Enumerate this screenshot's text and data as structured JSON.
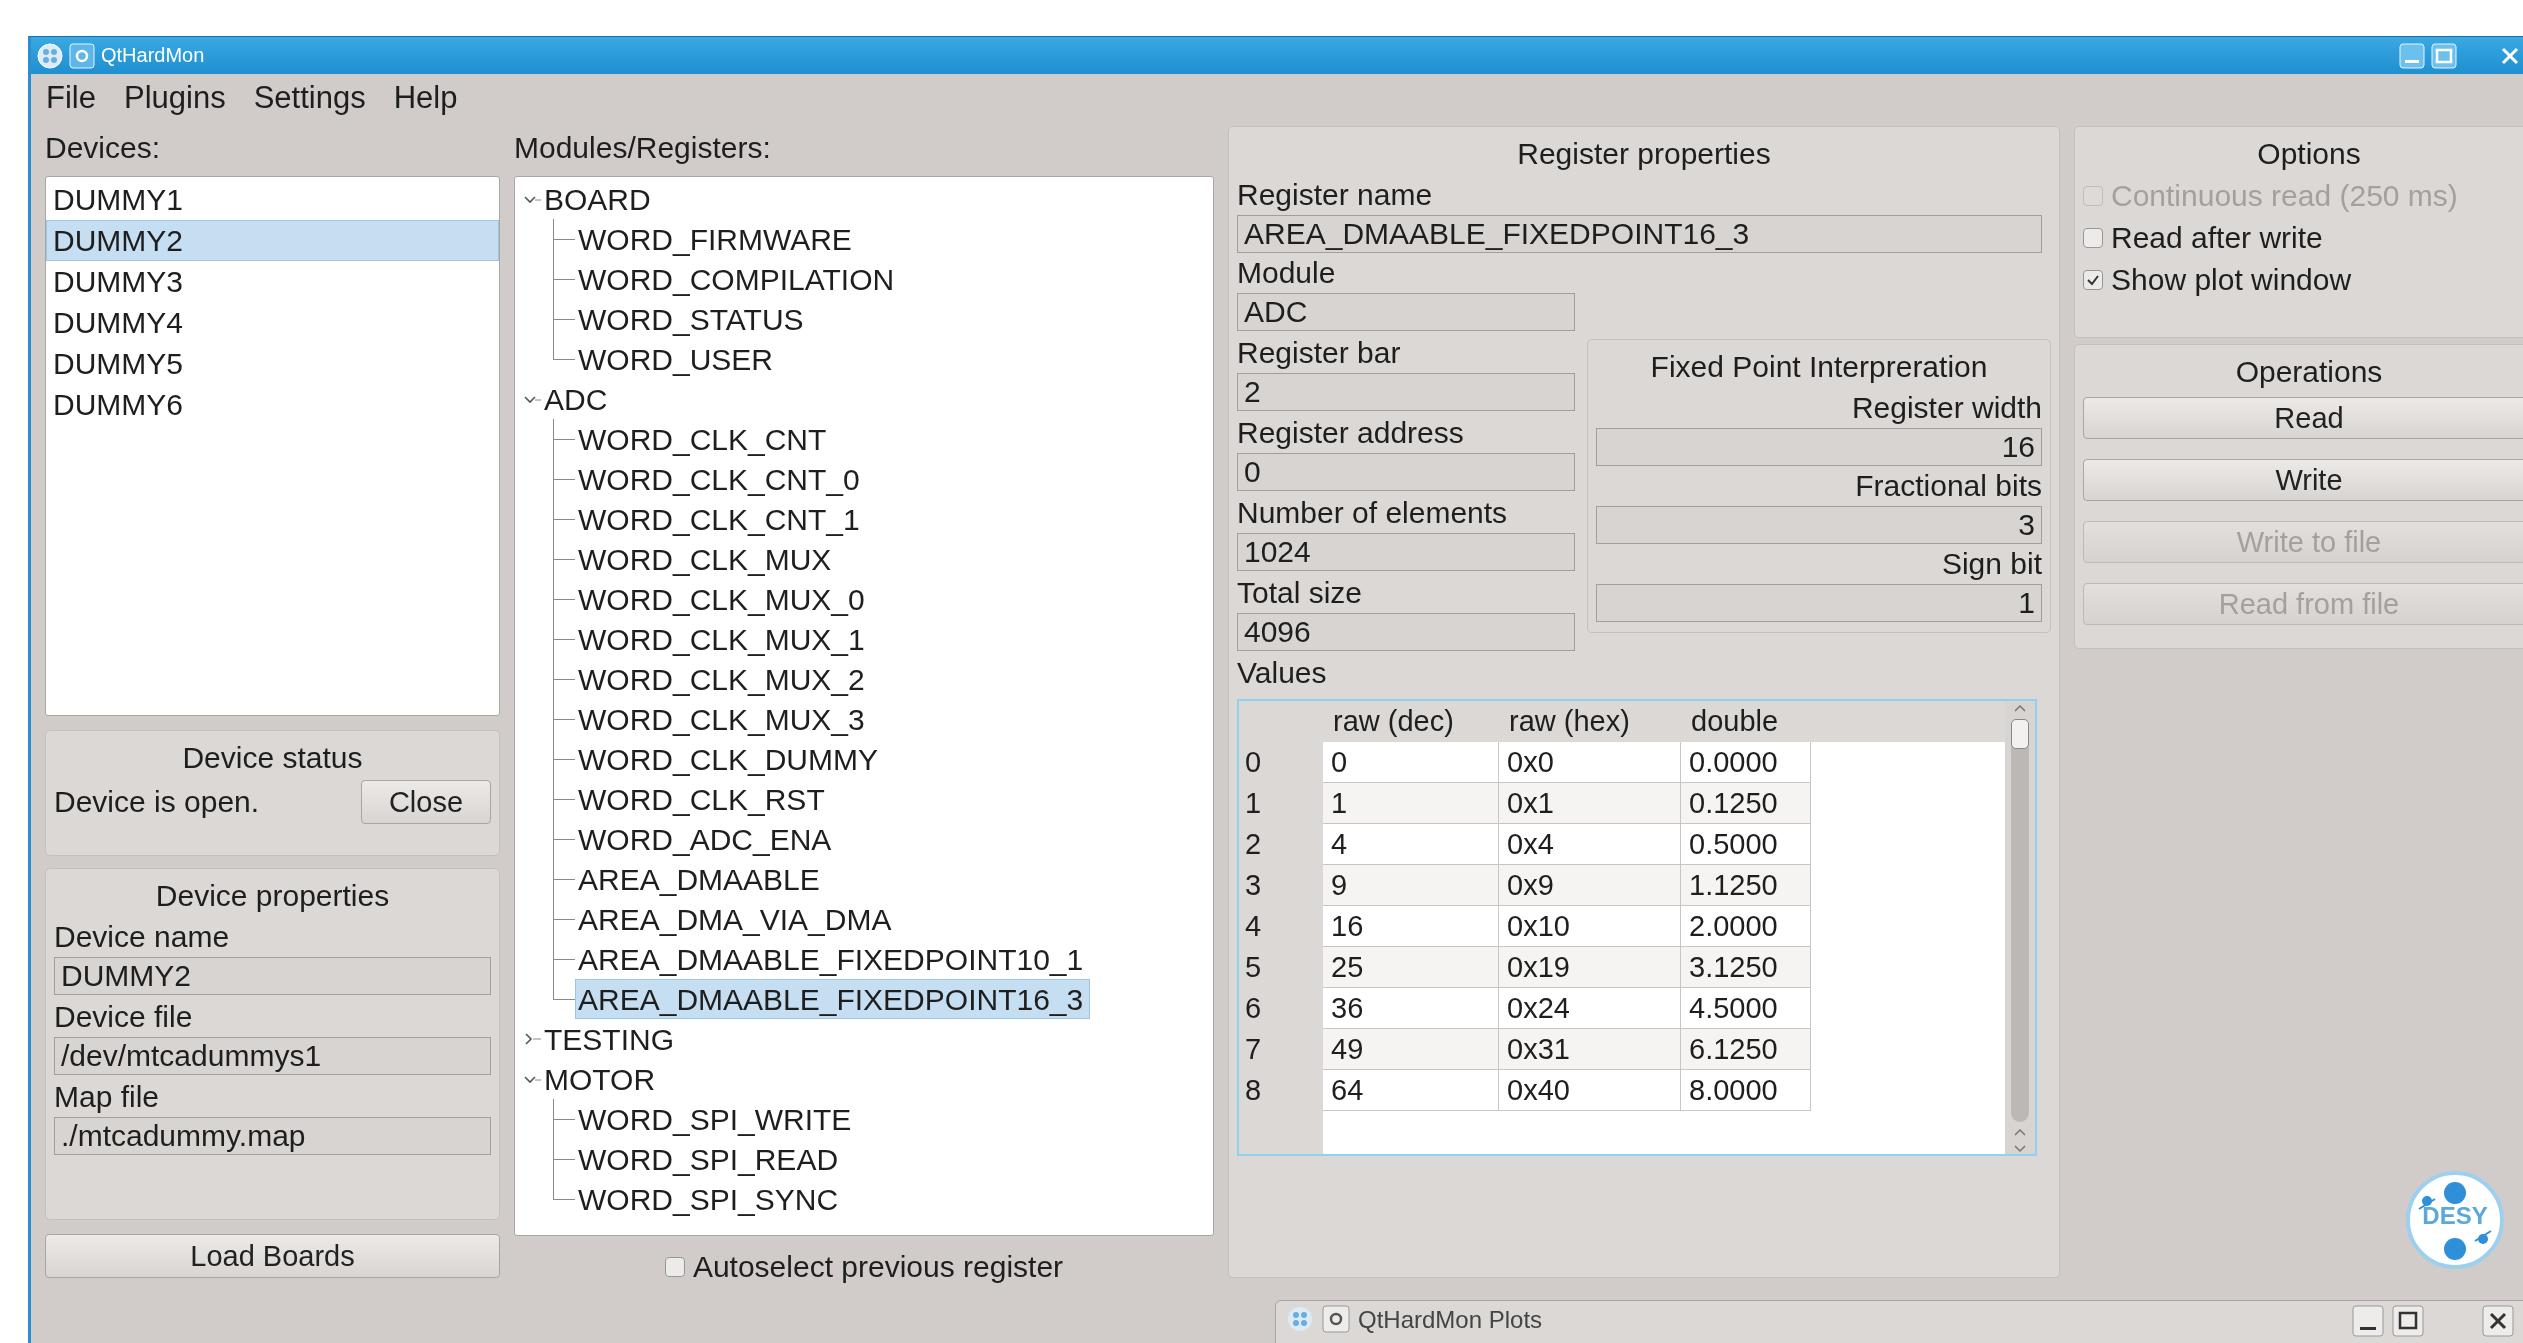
{
  "window": {
    "title": "QtHardMon"
  },
  "menu": [
    "File",
    "Plugins",
    "Settings",
    "Help"
  ],
  "devices": {
    "label": "Devices:",
    "items": [
      {
        "name": "DUMMY1",
        "selected": false
      },
      {
        "name": "DUMMY2",
        "selected": true
      },
      {
        "name": "DUMMY3",
        "selected": false
      },
      {
        "name": "DUMMY4",
        "selected": false
      },
      {
        "name": "DUMMY5",
        "selected": false
      },
      {
        "name": "DUMMY6",
        "selected": false
      }
    ]
  },
  "device_status": {
    "title": "Device status",
    "text": "Device is open.",
    "button": "Close"
  },
  "device_properties": {
    "title": "Device properties",
    "fields": [
      {
        "label": "Device name",
        "value": "DUMMY2"
      },
      {
        "label": "Device file",
        "value": "/dev/mtcadummys1"
      },
      {
        "label": "Map file",
        "value": "./mtcadummy.map"
      }
    ]
  },
  "load_button": "Load Boards",
  "modules": {
    "label": "Modules/Registers:",
    "tree": [
      {
        "name": "BOARD",
        "expanded": true,
        "selected": false,
        "children": [
          {
            "name": "WORD_FIRMWARE",
            "selected": false
          },
          {
            "name": "WORD_COMPILATION",
            "selected": false
          },
          {
            "name": "WORD_STATUS",
            "selected": false
          },
          {
            "name": "WORD_USER",
            "selected": false
          }
        ]
      },
      {
        "name": "ADC",
        "expanded": true,
        "selected": false,
        "children": [
          {
            "name": "WORD_CLK_CNT",
            "selected": false
          },
          {
            "name": "WORD_CLK_CNT_0",
            "selected": false
          },
          {
            "name": "WORD_CLK_CNT_1",
            "selected": false
          },
          {
            "name": "WORD_CLK_MUX",
            "selected": false
          },
          {
            "name": "WORD_CLK_MUX_0",
            "selected": false
          },
          {
            "name": "WORD_CLK_MUX_1",
            "selected": false
          },
          {
            "name": "WORD_CLK_MUX_2",
            "selected": false
          },
          {
            "name": "WORD_CLK_MUX_3",
            "selected": false
          },
          {
            "name": "WORD_CLK_DUMMY",
            "selected": false
          },
          {
            "name": "WORD_CLK_RST",
            "selected": false
          },
          {
            "name": "WORD_ADC_ENA",
            "selected": false
          },
          {
            "name": "AREA_DMAABLE",
            "selected": false
          },
          {
            "name": "AREA_DMA_VIA_DMA",
            "selected": false
          },
          {
            "name": "AREA_DMAABLE_FIXEDPOINT10_1",
            "selected": false
          },
          {
            "name": "AREA_DMAABLE_FIXEDPOINT16_3",
            "selected": true
          }
        ]
      },
      {
        "name": "TESTING",
        "expanded": false,
        "selected": false
      },
      {
        "name": "MOTOR",
        "expanded": true,
        "selected": false,
        "children": [
          {
            "name": "WORD_SPI_WRITE",
            "selected": false
          },
          {
            "name": "WORD_SPI_READ",
            "selected": false
          },
          {
            "name": "WORD_SPI_SYNC",
            "selected": false
          }
        ]
      }
    ],
    "autoselect": {
      "label": "Autoselect previous register",
      "checked": false
    }
  },
  "register_properties": {
    "title": "Register properties",
    "register_name": {
      "label": "Register name",
      "value": "AREA_DMAABLE_FIXEDPOINT16_3"
    },
    "fields": [
      {
        "label": "Module",
        "value": "ADC"
      },
      {
        "label": "Register bar",
        "value": "2"
      },
      {
        "label": "Register address",
        "value": "0"
      },
      {
        "label": "Number of elements",
        "value": "1024"
      },
      {
        "label": "Total size",
        "value": "4096"
      }
    ],
    "fixed_point": {
      "title": "Fixed Point Interpreration",
      "fields": [
        {
          "label": "Register width",
          "value": "16"
        },
        {
          "label": "Fractional bits",
          "value": "3"
        },
        {
          "label": "Sign bit",
          "value": "1"
        }
      ]
    },
    "values": {
      "label": "Values",
      "columns": [
        "raw (dec)",
        "raw (hex)",
        "double"
      ],
      "rows": [
        {
          "index": "0",
          "cells": [
            "0",
            "0x0",
            "0.0000"
          ]
        },
        {
          "index": "1",
          "cells": [
            "1",
            "0x1",
            "0.1250"
          ]
        },
        {
          "index": "2",
          "cells": [
            "4",
            "0x4",
            "0.5000"
          ]
        },
        {
          "index": "3",
          "cells": [
            "9",
            "0x9",
            "1.1250"
          ]
        },
        {
          "index": "4",
          "cells": [
            "16",
            "0x10",
            "2.0000"
          ]
        },
        {
          "index": "5",
          "cells": [
            "25",
            "0x19",
            "3.1250"
          ]
        },
        {
          "index": "6",
          "cells": [
            "36",
            "0x24",
            "4.5000"
          ]
        },
        {
          "index": "7",
          "cells": [
            "49",
            "0x31",
            "6.1250"
          ]
        },
        {
          "index": "8",
          "cells": [
            "64",
            "0x40",
            "8.0000"
          ]
        }
      ]
    }
  },
  "options": {
    "title": "Options",
    "checkboxes": [
      {
        "label": "Continuous read (250 ms)",
        "checked": false,
        "disabled": true
      },
      {
        "label": "Read after write",
        "checked": false,
        "disabled": false
      },
      {
        "label": "Show plot window",
        "checked": true,
        "disabled": false
      }
    ]
  },
  "operations": {
    "title": "Operations",
    "buttons": [
      {
        "label": "Read",
        "disabled": false
      },
      {
        "label": "Write",
        "disabled": false
      },
      {
        "label": "Write to file",
        "disabled": true
      },
      {
        "label": "Read from file",
        "disabled": true
      }
    ]
  },
  "logo": {
    "text": "DESY"
  },
  "plots_window": {
    "title": "QtHardMon Plots"
  }
}
